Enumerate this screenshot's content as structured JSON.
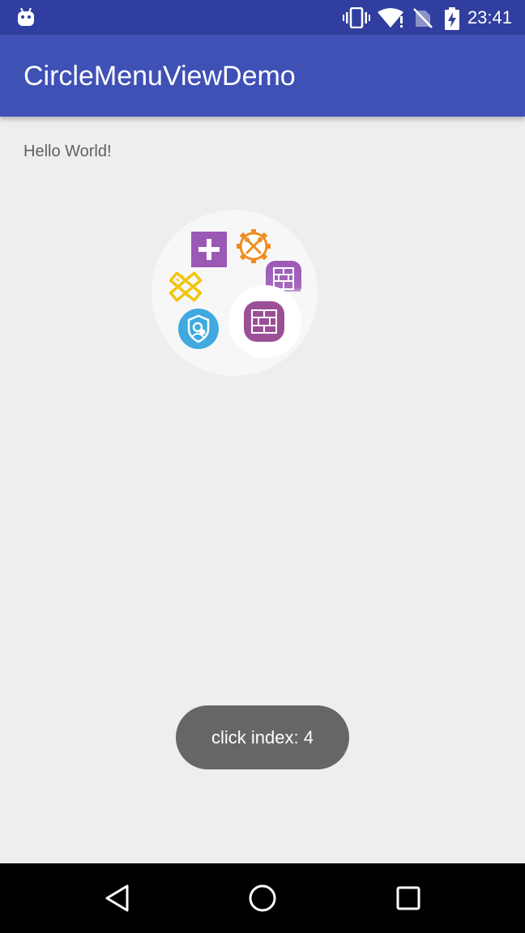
{
  "status_bar": {
    "time": "23:41",
    "icons": [
      "android-debug-icon",
      "vibrate-icon",
      "wifi-icon",
      "no-sim-icon",
      "battery-charging-icon"
    ],
    "background": "#303f9f"
  },
  "app_bar": {
    "title": "CircleMenuViewDemo",
    "background": "#3f51b5"
  },
  "content": {
    "hello_text": "Hello World!"
  },
  "circle_menu": {
    "items": [
      {
        "name": "add-icon",
        "color": "#9b59b6"
      },
      {
        "name": "settings-tools-icon",
        "color": "#f08c1e"
      },
      {
        "name": "brick-wall-icon",
        "color": "#9b59b6"
      },
      {
        "name": "ruler-pencil-icon",
        "color": "#f1c40f"
      },
      {
        "name": "security-shield-icon",
        "color": "#3fa9e0"
      }
    ],
    "center": {
      "name": "brick-wall-icon",
      "color": "#9b4f96"
    }
  },
  "toast": {
    "text": "click index: 4"
  },
  "nav_bar": {
    "buttons": [
      "back-icon",
      "home-icon",
      "recents-icon"
    ]
  }
}
